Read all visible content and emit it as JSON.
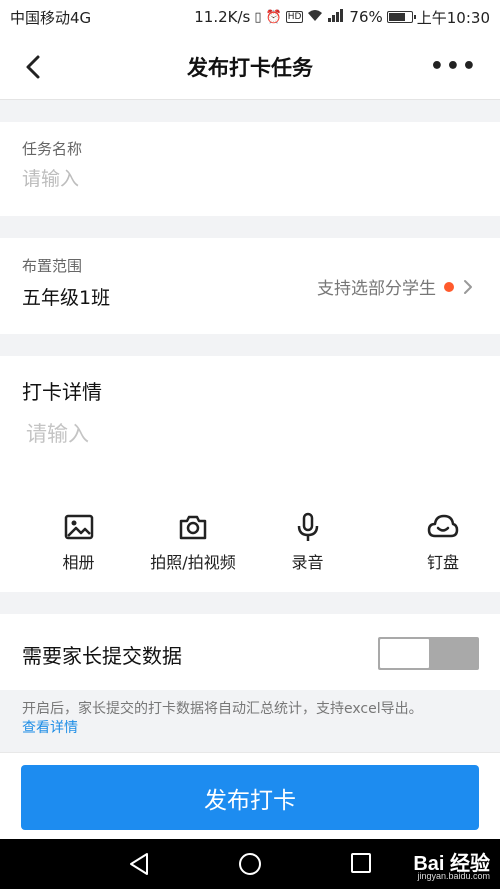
{
  "statusbar": {
    "carrier": "中国移动4G",
    "speed": "11.2K/s",
    "signal": "4G",
    "battery_percent": "76%",
    "battery_level": 0.76,
    "time": "上午10:30"
  },
  "navbar": {
    "title": "发布打卡任务",
    "more": "•••"
  },
  "task_name": {
    "label": "任务名称",
    "placeholder": "请输入"
  },
  "scope": {
    "label": "布置范围",
    "value": "五年级1班",
    "option": "支持选部分学生"
  },
  "details": {
    "title": "打卡详情",
    "placeholder": "请输入",
    "tools": [
      {
        "label": "相册",
        "icon": "image-icon"
      },
      {
        "label": "拍照/拍视频",
        "icon": "camera-icon"
      },
      {
        "label": "录音",
        "icon": "microphone-icon"
      },
      {
        "label": "钉盘",
        "icon": "cloud-icon"
      }
    ]
  },
  "parent_data": {
    "label": "需要家长提交数据",
    "enabled": false,
    "hint": "开启后，家长提交的打卡数据将自动汇总统计，支持excel导出。",
    "link": "查看详情"
  },
  "publish_button": "发布打卡",
  "watermark": {
    "text": "Bai 经验",
    "sub": "jingyan.baidu.com"
  },
  "colors": {
    "accent": "#1d8cf0",
    "dot": "#ff5a2c",
    "link": "#1f8ee6"
  }
}
